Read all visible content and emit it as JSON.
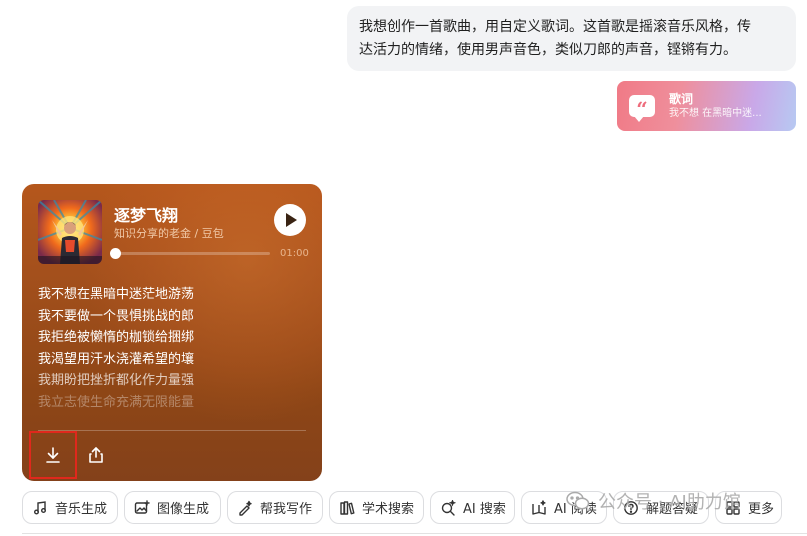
{
  "user_message": {
    "line1": "我想创作一首歌曲，用自定义歌词。这首歌是摇滚音乐风格，传",
    "line2": "达活力的情绪，使用男声音色，类似刀郎的声音，铿锵有力。"
  },
  "lyrics_attachment": {
    "icon": "quote-icon",
    "title": "歌词",
    "preview": "我不想 在黑暗中迷..."
  },
  "song": {
    "title": "逐梦飞翔",
    "artist": "知识分享的老金 / 豆包",
    "duration": "01:00",
    "progress": 0,
    "lyrics": [
      "我不想在黑暗中迷茫地游荡",
      "我不要做一个畏惧挑战的郎",
      "我拒绝被懒惰的枷锁给捆绑",
      "我渴望用汗水浇灌希望的壤",
      "我期盼把挫折都化作力量强",
      "我立志使生命充满无限能量"
    ],
    "actions": {
      "download_icon": "download-icon",
      "share_icon": "share-icon"
    }
  },
  "chips": [
    {
      "label": "音乐生成",
      "icon": "music-note-icon"
    },
    {
      "label": "图像生成",
      "icon": "image-plus-icon"
    },
    {
      "label": "帮我写作",
      "icon": "pen-sparkle-icon"
    },
    {
      "label": "学术搜索",
      "icon": "books-icon"
    },
    {
      "label": "AI 搜索",
      "icon": "search-sparkle-icon"
    },
    {
      "label": "AI 阅读",
      "icon": "book-sparkle-icon"
    },
    {
      "label": "解题答疑",
      "icon": "question-icon"
    },
    {
      "label": "更多",
      "icon": "grid-icon"
    }
  ],
  "watermark": {
    "text": "公众号 · AI肋力馆",
    "icon": "wechat-icon"
  },
  "colors": {
    "card_brown": "#9a4c1a",
    "highlight_red": "#e0281c",
    "chip_border": "#dcdde0",
    "bubble_bg": "#f2f3f5"
  }
}
